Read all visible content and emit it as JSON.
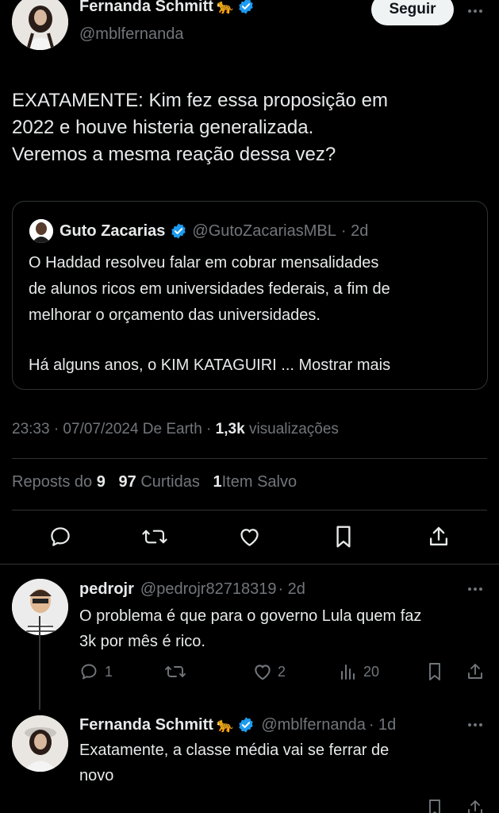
{
  "colors": {
    "background": "#000000",
    "text": "#e7e9ea",
    "muted": "#71767b",
    "border": "#2f3336",
    "verified": "#1d9bf0"
  },
  "main_tweet": {
    "author_name": "Fernanda Schmitt",
    "author_emoji": "🐆",
    "handle": "@mblfernanda",
    "follow_label": "Seguir",
    "body_lines": [
      "EXATAMENTE: Kim fez essa proposição em",
      "2022 e houve histeria generalizada.",
      "Veremos a mesma reação dessa vez?"
    ],
    "quote": {
      "author_name": "Guto Zacarias",
      "handle": "@GutoZacariasMBL",
      "time": "· 2d",
      "lines": [
        "O Haddad resolveu falar em cobrar mensalidades",
        "de alunos ricos em universidades federais, a fim de",
        "melhorar o orçamento das universidades."
      ],
      "last_line": "Há alguns anos, o KIM KATAGUIRI ...",
      "show_more": "Mostrar mais"
    },
    "meta": {
      "time": "23:33 · 07/07/2024 De Earth ·",
      "views_count": "1,3k",
      "views_label": "visualizações"
    },
    "stats": {
      "reposts_label": "Reposts do",
      "reposts_count": "9",
      "likes_count": "97",
      "likes_label": "Curtidas",
      "saves_count": "1",
      "saves_label": "Item Salvo"
    },
    "actions": [
      "reply-icon",
      "repost-icon",
      "like-icon",
      "bookmark-icon",
      "share-icon"
    ]
  },
  "replies": [
    {
      "author_name": "pedrojr",
      "handle": "@pedrojr82718319",
      "time": "· 2d",
      "lines": [
        "O problema é que para o governo Lula quem faz",
        "3k por mês é rico."
      ],
      "reply_count": "1",
      "repost_count": "",
      "like_count": "2",
      "views_count": "20"
    },
    {
      "author_name": "Fernanda Schmitt",
      "author_emoji": "🐆",
      "handle": "@mblfernanda",
      "time": "· 1d",
      "lines": [
        "Exatamente, a classe média vai se ferrar de",
        "novo"
      ]
    }
  ]
}
